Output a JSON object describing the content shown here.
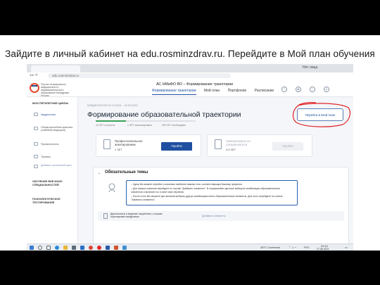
{
  "slide": {
    "title": "Зайдите в личный кабинет на edu.rosminzdrav.ru. Перейдите в Мой план обучения"
  },
  "browser": {
    "tab_title": "edu.rosminzdrav.ru",
    "url": "edu.rosminzdrav.ru",
    "right_tab": "Нет лица"
  },
  "header": {
    "org_name": "Портал непрерывного медицинского и фармацевтического образования Минздрава России",
    "system_name": "АС НМиФО ВО – Формирование траектории",
    "nav": [
      "Формирование траектории",
      "Мой план",
      "Портфолио",
      "Расписание"
    ],
    "icons": [
      "help-icon",
      "eye-icon",
      "bell-icon",
      "user-icon"
    ]
  },
  "sidebar": {
    "section1": "МОИ ПЯТИЛЕТНИЕ ЦИКЛЫ",
    "items": [
      {
        "label": "Кардиология",
        "active": true
      },
      {
        "label": "Общая врачебная практика (семейная медицина)",
        "active": false
      },
      {
        "label": "Пульмонология",
        "active": false
      },
      {
        "label": "Терапия",
        "active": false
      },
      {
        "label": "Добавить пятилетний цикл",
        "active": false
      }
    ],
    "section2": "ОБУЧЕНИЕ ВНЕ МОИХ СПЕЦИАЛЬНОСТЕЙ",
    "section3": "ПСИХОЛОГИЧЕСКОЕ ТЕСТИРОВАНИЕ"
  },
  "main": {
    "crumb": "КАРДИОЛОГИЯ  02.03.2018 – 02.03.2023",
    "title": "Формирование образовательной траектории",
    "plan_button": "Перейти в Мой план",
    "progress": {
      "fraction": 0.3,
      "labels": [
        "44 ЗЕТ получено",
        "1 ЗЕТ запланировано",
        "250 ЗЕТ необходимо"
      ]
    },
    "cards": [
      {
        "title": "Профессиональное анкетирование",
        "sub": "1 ЗЕТ",
        "button": "Пройти",
        "enabled": true
      },
      {
        "title": "Самоконтроль по специальности",
        "sub": "0,5 ЗЕТ",
        "button": "Пройти",
        "enabled": false
      }
    ],
    "section": {
      "title": "Обязательные темы",
      "info_lines": [
        "– Здесь Вы можете перейти к освоению наиболее важных тем, соответствующих Вашему профилю.",
        "– Для начала освоения перейдите по ссылке \"Добавить элементы\". В открывшейся карточке выберите комбинацию образовательных",
        "элементов и включите их в свой план обучения.",
        "– После этого Вы сможете при желании выбрать другую комбинацию и/или образовательные элементы. Для этого перейдите по ссылке",
        "\"Заменить элементы\"."
      ],
      "row": {
        "text": "Диагностика и ведение пациентов с острым коронарным синдромом",
        "link": "Добавить элементы"
      }
    }
  },
  "taskbar": {
    "weather": "28°C  Солнечно",
    "lang": "РУС",
    "time": "20:12",
    "date": "27.06.2021"
  },
  "colors": {
    "accent": "#1e4fa0",
    "highlight": "#e0262b",
    "progress": "#3aa35a"
  }
}
